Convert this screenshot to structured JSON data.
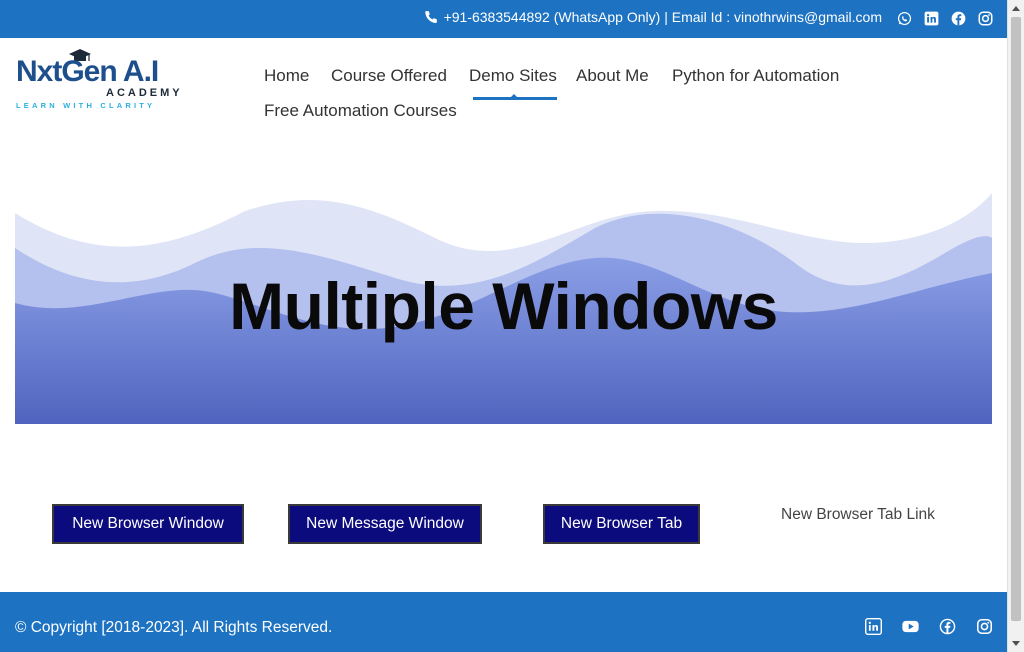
{
  "topbar": {
    "contact_text": "+91-6383544892 (WhatsApp Only) | Email Id : vinothrwins@gmail.com",
    "icons": [
      "phone-icon",
      "whatsapp-icon",
      "linkedin-icon",
      "facebook-icon",
      "instagram-icon"
    ]
  },
  "logo": {
    "brand": "NxtGen A.I",
    "academy": "ACADEMY",
    "tagline": "LEARN WITH CLARITY"
  },
  "nav": {
    "items": [
      "Home",
      "Course Offered",
      "Demo Sites",
      "About Me",
      "Python for Automation",
      "Free Automation Courses"
    ],
    "active": "Demo Sites"
  },
  "hero": {
    "title": "Multiple Windows"
  },
  "actions": {
    "new_browser_window": "New Browser Window",
    "new_message_window": "New Message Window",
    "new_browser_tab": "New Browser Tab",
    "new_browser_tab_link": "New Browser Tab Link"
  },
  "footer": {
    "copyright": "© Copyright [2018-2023]. All Rights Reserved.",
    "icons": [
      "linkedin-icon",
      "youtube-icon",
      "facebook-icon",
      "instagram-icon"
    ]
  },
  "colors": {
    "brand_blue": "#1d72c2",
    "button_navy": "#0b0b7e",
    "hero_wave": "#6b7fd4"
  }
}
